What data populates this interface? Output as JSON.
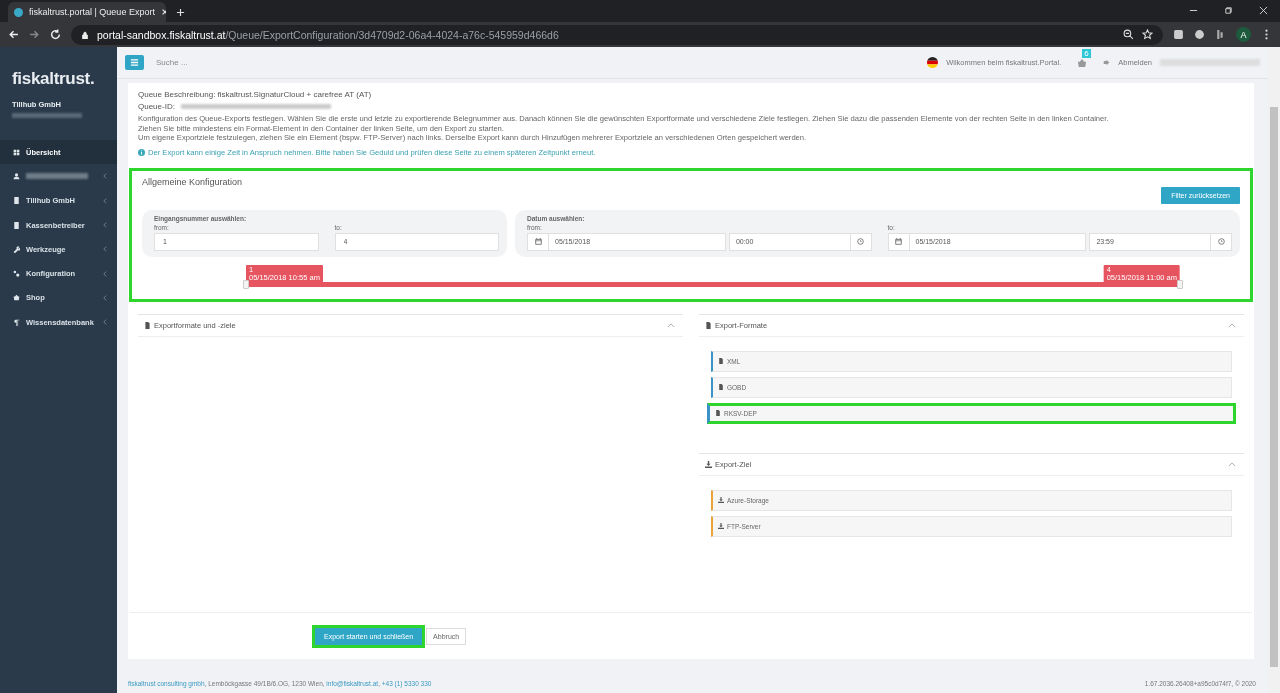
{
  "browser": {
    "tab_title": "fiskaltrust.portal | Queue Export",
    "url_host": "portal-sandbox.fiskaltrust.at",
    "url_path": "/Queue/ExportConfiguration/3d4709d2-06a4-4024-a76c-545959d466d6",
    "profile_initial": "A"
  },
  "sidebar": {
    "logo": "fiskaltrust.",
    "company": "Tillhub GmbH",
    "items": [
      {
        "kind": "link",
        "label": "Übersicht",
        "selected": true
      },
      {
        "kind": "redacted",
        "selected": false
      },
      {
        "kind": "link",
        "label": "Tillhub GmbH",
        "selected": false
      },
      {
        "kind": "link",
        "label": "Kassenbetreiber",
        "selected": false
      },
      {
        "kind": "link",
        "label": "Werkzeuge",
        "selected": false
      },
      {
        "kind": "link",
        "label": "Konfiguration",
        "selected": false
      },
      {
        "kind": "link",
        "label": "Shop",
        "selected": false
      },
      {
        "kind": "link",
        "label": "Wissensdatenbank",
        "selected": false
      }
    ]
  },
  "topbar": {
    "search_placeholder": "Suche ...",
    "welcome": "Wilkommen beim fiskaltrust.Portal.",
    "cart_badge": "6",
    "logout": "Abmelden"
  },
  "description": {
    "title": "Queue Beschreibung: fiskaltrust.SignaturCloud + carefree AT (AT)",
    "queue_id_label": "Queue-ID:",
    "lines": [
      "Konfiguration des Queue-Exports festlegen. Wählen Sie die erste und letzte zu exportierende Belegnummer aus. Danach können Sie die gewünschten Exportformate und verschiedene Ziele festlegen. Ziehen Sie dazu die passenden Elemente von der rechten Seite in den linken Container.",
      "Ziehen Sie bitte mindestens ein Format-Element in den Container der linken Seite, um den Export zu starten.",
      "Um eigene Exportziele festzulegen, ziehen Sie ein Element (bspw. FTP-Server) nach links. Derselbe Export kann durch Hinzufügen mehrerer Exportziele an verschiedenen Orten gespeichert werden."
    ],
    "info": "Der Export kann einige Zeit in Anspruch nehmen. Bitte haben Sie Geduld und prüfen diese Seite zu einem späteren Zeitpunkt erneut."
  },
  "config": {
    "title": "Allgemeine Konfiguration",
    "highlighted": true,
    "reset_button": "Filter zurücksetzen",
    "receipt": {
      "title": "Eingangsnummer auswählen:",
      "from_label": "from:",
      "from_value": "1",
      "to_label": "to:",
      "to_value": "4"
    },
    "date": {
      "title": "Datum auswählen:",
      "from_label": "from:",
      "from_date": "05/15/2018",
      "from_time": "00:00",
      "to_label": "to:",
      "to_date": "05/15/2018",
      "to_time": "23:59"
    },
    "slider": {
      "handles": [
        {
          "value": "1",
          "time": "05/15/2018 10:55 am",
          "level": 0
        },
        {
          "value": "4",
          "time": "05/15/2018 11:00 am",
          "level": 1
        }
      ]
    }
  },
  "panels": {
    "left": {
      "title": "Exportformate und -ziele"
    },
    "formats": {
      "title": "Export-Formate",
      "items": [
        {
          "label": "XML",
          "highlighted": false
        },
        {
          "label": "GOBD",
          "highlighted": false
        },
        {
          "label": "RKSV-DEP",
          "highlighted": true
        }
      ]
    },
    "targets": {
      "title": "Export-Ziel",
      "items": [
        {
          "label": "Azure-Storage",
          "highlighted": false
        },
        {
          "label": "FTP-Server",
          "highlighted": false
        }
      ]
    }
  },
  "actions": {
    "primary": "Export starten und schließen",
    "primary_highlighted": true,
    "secondary": "Abbruch"
  },
  "footer": {
    "company": "fiskaltrust consulting gmbh",
    "address": ", Lemböckgasse 49/1B/6.OG, 1230 Wien, ",
    "email": "info@fiskaltrust.at",
    "separator": ", ",
    "phone": "+43 (1) 5330 330",
    "version": "1.67.2036.26408+a95c0d74f7, © 2020"
  }
}
